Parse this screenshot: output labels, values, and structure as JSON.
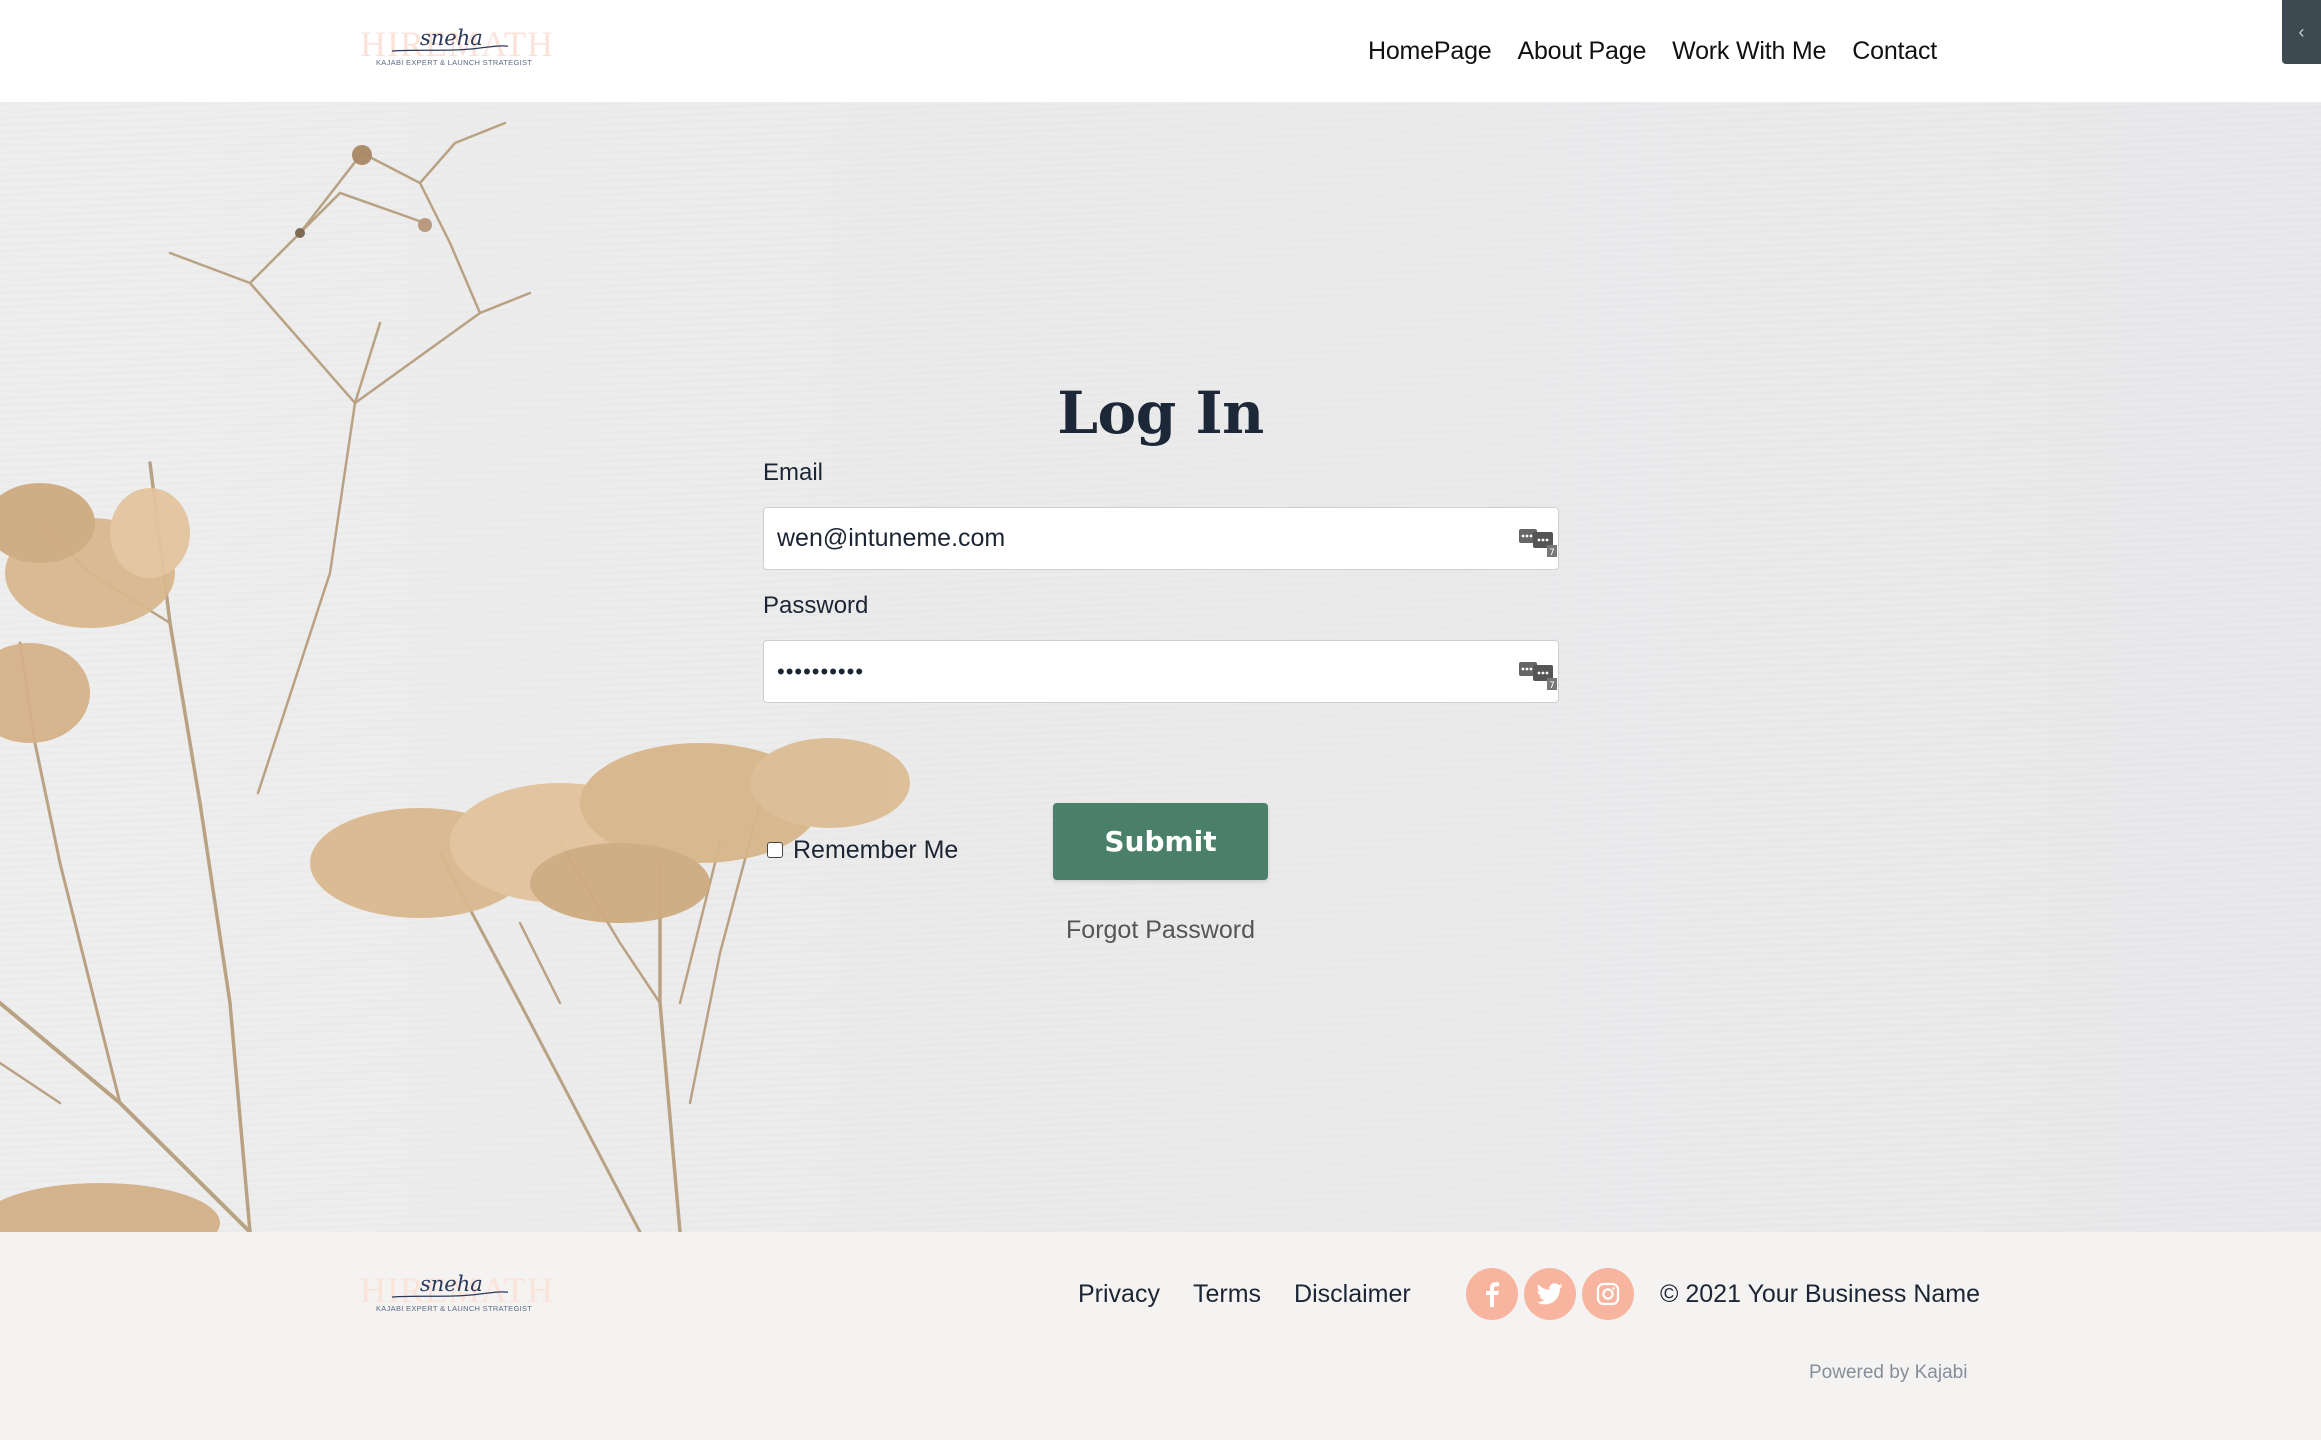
{
  "brand": {
    "wordmark": "HIREMATH",
    "script_name": "sneha",
    "tagline": "KAJABI EXPERT & LAUNCH STRATEGIST"
  },
  "nav": {
    "items": [
      {
        "label": "HomePage"
      },
      {
        "label": "About Page"
      },
      {
        "label": "Work With Me"
      },
      {
        "label": "Contact"
      }
    ],
    "side_toggle_icon": "chevron-left-icon",
    "side_toggle_glyph": "‹"
  },
  "login": {
    "title": "Log In",
    "email_label": "Email",
    "email_value": "wen@intuneme.com",
    "password_label": "Password",
    "password_value": "••••••••••",
    "field_badge": "7",
    "remember_label": "Remember Me",
    "remember_checked": false,
    "submit_label": "Submit",
    "forgot_label": "Forgot Password"
  },
  "footer": {
    "links": [
      {
        "label": "Privacy"
      },
      {
        "label": "Terms"
      },
      {
        "label": "Disclaimer"
      }
    ],
    "socials": [
      {
        "name": "facebook",
        "icon": "facebook-icon"
      },
      {
        "name": "twitter",
        "icon": "twitter-icon"
      },
      {
        "name": "instagram",
        "icon": "instagram-icon"
      }
    ],
    "copyright": "© 2021 Your Business Name",
    "powered_by": "Powered by Kajabi"
  },
  "colors": {
    "accent_green": "#4a7f6a",
    "social_peach": "#f7b5a0",
    "text_dark": "#1c2533",
    "toggle_bg": "#3d4a52"
  }
}
